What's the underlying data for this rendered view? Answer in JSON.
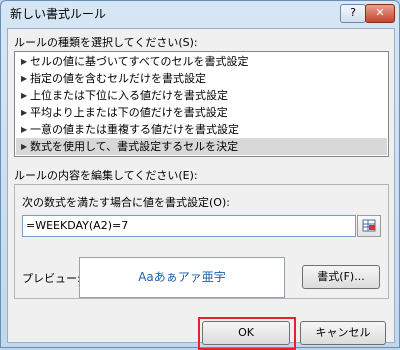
{
  "window": {
    "title": "新しい書式ルール",
    "help_label": "?",
    "close_label": "✕"
  },
  "rule_type": {
    "label": "ルールの種類を選択してください(S):",
    "items": [
      "セルの値に基づいてすべてのセルを書式設定",
      "指定の値を含むセルだけを書式設定",
      "上位または下位に入る値だけを書式設定",
      "平均より上または下の値だけを書式設定",
      "一意の値または重複する値だけを書式設定",
      "数式を使用して、書式設定するセルを決定"
    ],
    "selected_index": 5
  },
  "rule_edit": {
    "label": "ルールの内容を編集してください(E):",
    "formula_label": "次の数式を満たす場合に値を書式設定(O):",
    "formula_value": "=WEEKDAY(A2)=7",
    "preview_label": "プレビュー:",
    "preview_text": "Aaあぁアァ亜宇",
    "format_button": "書式(F)..."
  },
  "footer": {
    "ok_label": "OK",
    "cancel_label": "キャンセル",
    "highlight_color": "#e5222d"
  }
}
